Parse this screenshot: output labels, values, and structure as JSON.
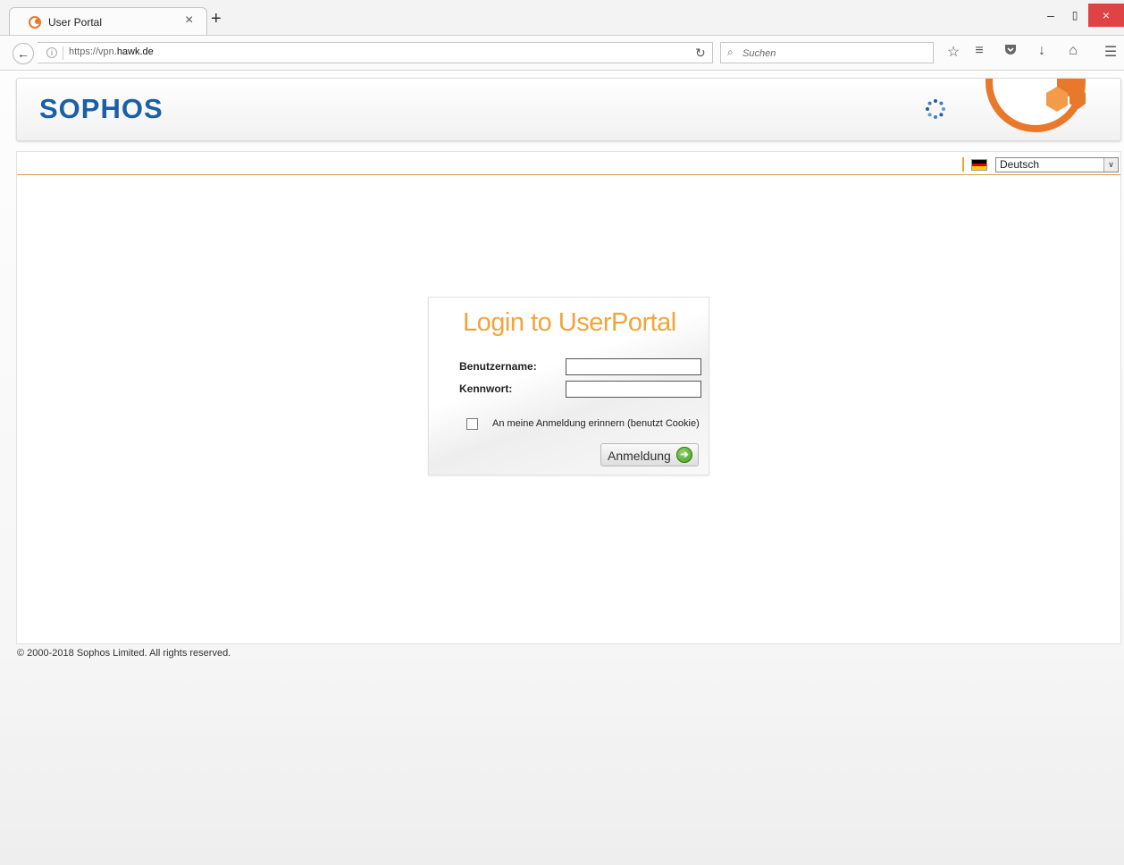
{
  "browser": {
    "tab_title": "User Portal",
    "tab_close": "×",
    "new_tab": "+",
    "url_prefix": "https://vpn.",
    "url_host": "hawk.de",
    "search_placeholder": "Suchen",
    "window_controls": {
      "minimize": "–",
      "maximize": "▯",
      "close": "×"
    },
    "icons": [
      "star-icon",
      "reading-list-icon",
      "pocket-icon",
      "download-icon",
      "home-icon",
      "menu-icon"
    ]
  },
  "header": {
    "brand": "SOPHOS",
    "accent_color": "#e8782a",
    "brand_color": "#1b5fa7"
  },
  "language": {
    "selected": "Deutsch"
  },
  "login": {
    "title": "Login to UserPortal",
    "username_label": "Benutzername:",
    "username_value": "",
    "password_label": "Kennwort:",
    "password_value": "",
    "remember_label": "An meine Anmeldung erinnern (benutzt Cookie)",
    "remember_checked": false,
    "submit_label": "Anmeldung",
    "title_color": "#f0a53c"
  },
  "footer": {
    "copyright": "© 2000-2018 Sophos Limited. All rights reserved."
  }
}
